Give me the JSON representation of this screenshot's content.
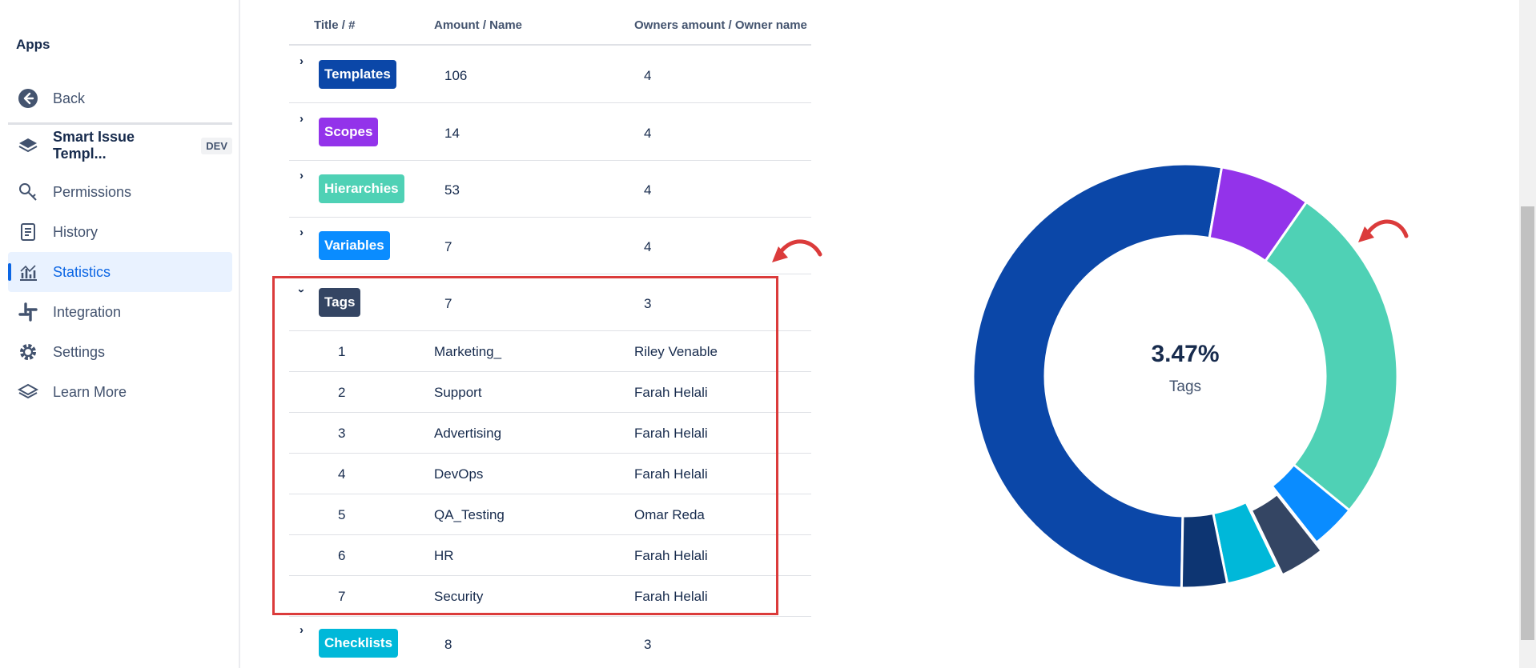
{
  "sidebar": {
    "title": "Apps",
    "items": [
      {
        "label": "Back",
        "icon": "back-arrow-icon"
      },
      {
        "label": "Smart Issue Templ...",
        "badge": "DEV",
        "icon": "layers-icon"
      },
      {
        "label": "Permissions",
        "icon": "key-icon"
      },
      {
        "label": "History",
        "icon": "history-icon"
      },
      {
        "label": "Statistics",
        "icon": "chart-icon",
        "active": true
      },
      {
        "label": "Integration",
        "icon": "slack-icon"
      },
      {
        "label": "Settings",
        "icon": "gear-icon"
      },
      {
        "label": "Learn More",
        "icon": "layers-icon"
      }
    ]
  },
  "table": {
    "headers": [
      "Title / #",
      "Amount / Name",
      "Owners amount / Owner name"
    ],
    "groups": [
      {
        "title": "Templates",
        "amount": "106",
        "owners": "4",
        "color": "#0b47a8",
        "expanded": false
      },
      {
        "title": "Scopes",
        "amount": "14",
        "owners": "4",
        "color": "#9333ea",
        "expanded": false
      },
      {
        "title": "Hierarchies",
        "amount": "53",
        "owners": "4",
        "color": "#4fd1b5",
        "expanded": false
      },
      {
        "title": "Variables",
        "amount": "7",
        "owners": "4",
        "color": "#0a8cff",
        "expanded": false
      },
      {
        "title": "Tags",
        "amount": "7",
        "owners": "3",
        "color": "#344563",
        "expanded": true
      },
      {
        "title": "Checklists",
        "amount": "8",
        "owners": "3",
        "color": "#00b8d9",
        "expanded": false
      }
    ],
    "tag_rows": [
      {
        "num": "1",
        "name": "Marketing_",
        "owner": "Riley Venable"
      },
      {
        "num": "2",
        "name": "Support",
        "owner": "Farah Helali"
      },
      {
        "num": "3",
        "name": "Advertising",
        "owner": "Farah Helali"
      },
      {
        "num": "4",
        "name": "DevOps",
        "owner": "Farah Helali"
      },
      {
        "num": "5",
        "name": "QA_Testing",
        "owner": "Omar Reda"
      },
      {
        "num": "6",
        "name": "HR",
        "owner": "Farah Helali"
      },
      {
        "num": "7",
        "name": "Security",
        "owner": "Farah Helali"
      }
    ]
  },
  "donut": {
    "center_value": "3.47%",
    "center_label": "Tags",
    "segments": [
      {
        "name": "Templates",
        "value": 106,
        "color": "#0b47a8"
      },
      {
        "name": "Scopes",
        "value": 14,
        "color": "#9333ea"
      },
      {
        "name": "Hierarchies",
        "value": 53,
        "color": "#4fd1b5"
      },
      {
        "name": "Variables",
        "value": 7,
        "color": "#0a8cff"
      },
      {
        "name": "Tags",
        "value": 7,
        "color": "#344563"
      },
      {
        "name": "Checklists",
        "value": 8,
        "color": "#00b8d9"
      },
      {
        "name": "",
        "value": 7,
        "color": "#0d3572"
      }
    ]
  },
  "annotation": {
    "color": "#db3b3b"
  }
}
